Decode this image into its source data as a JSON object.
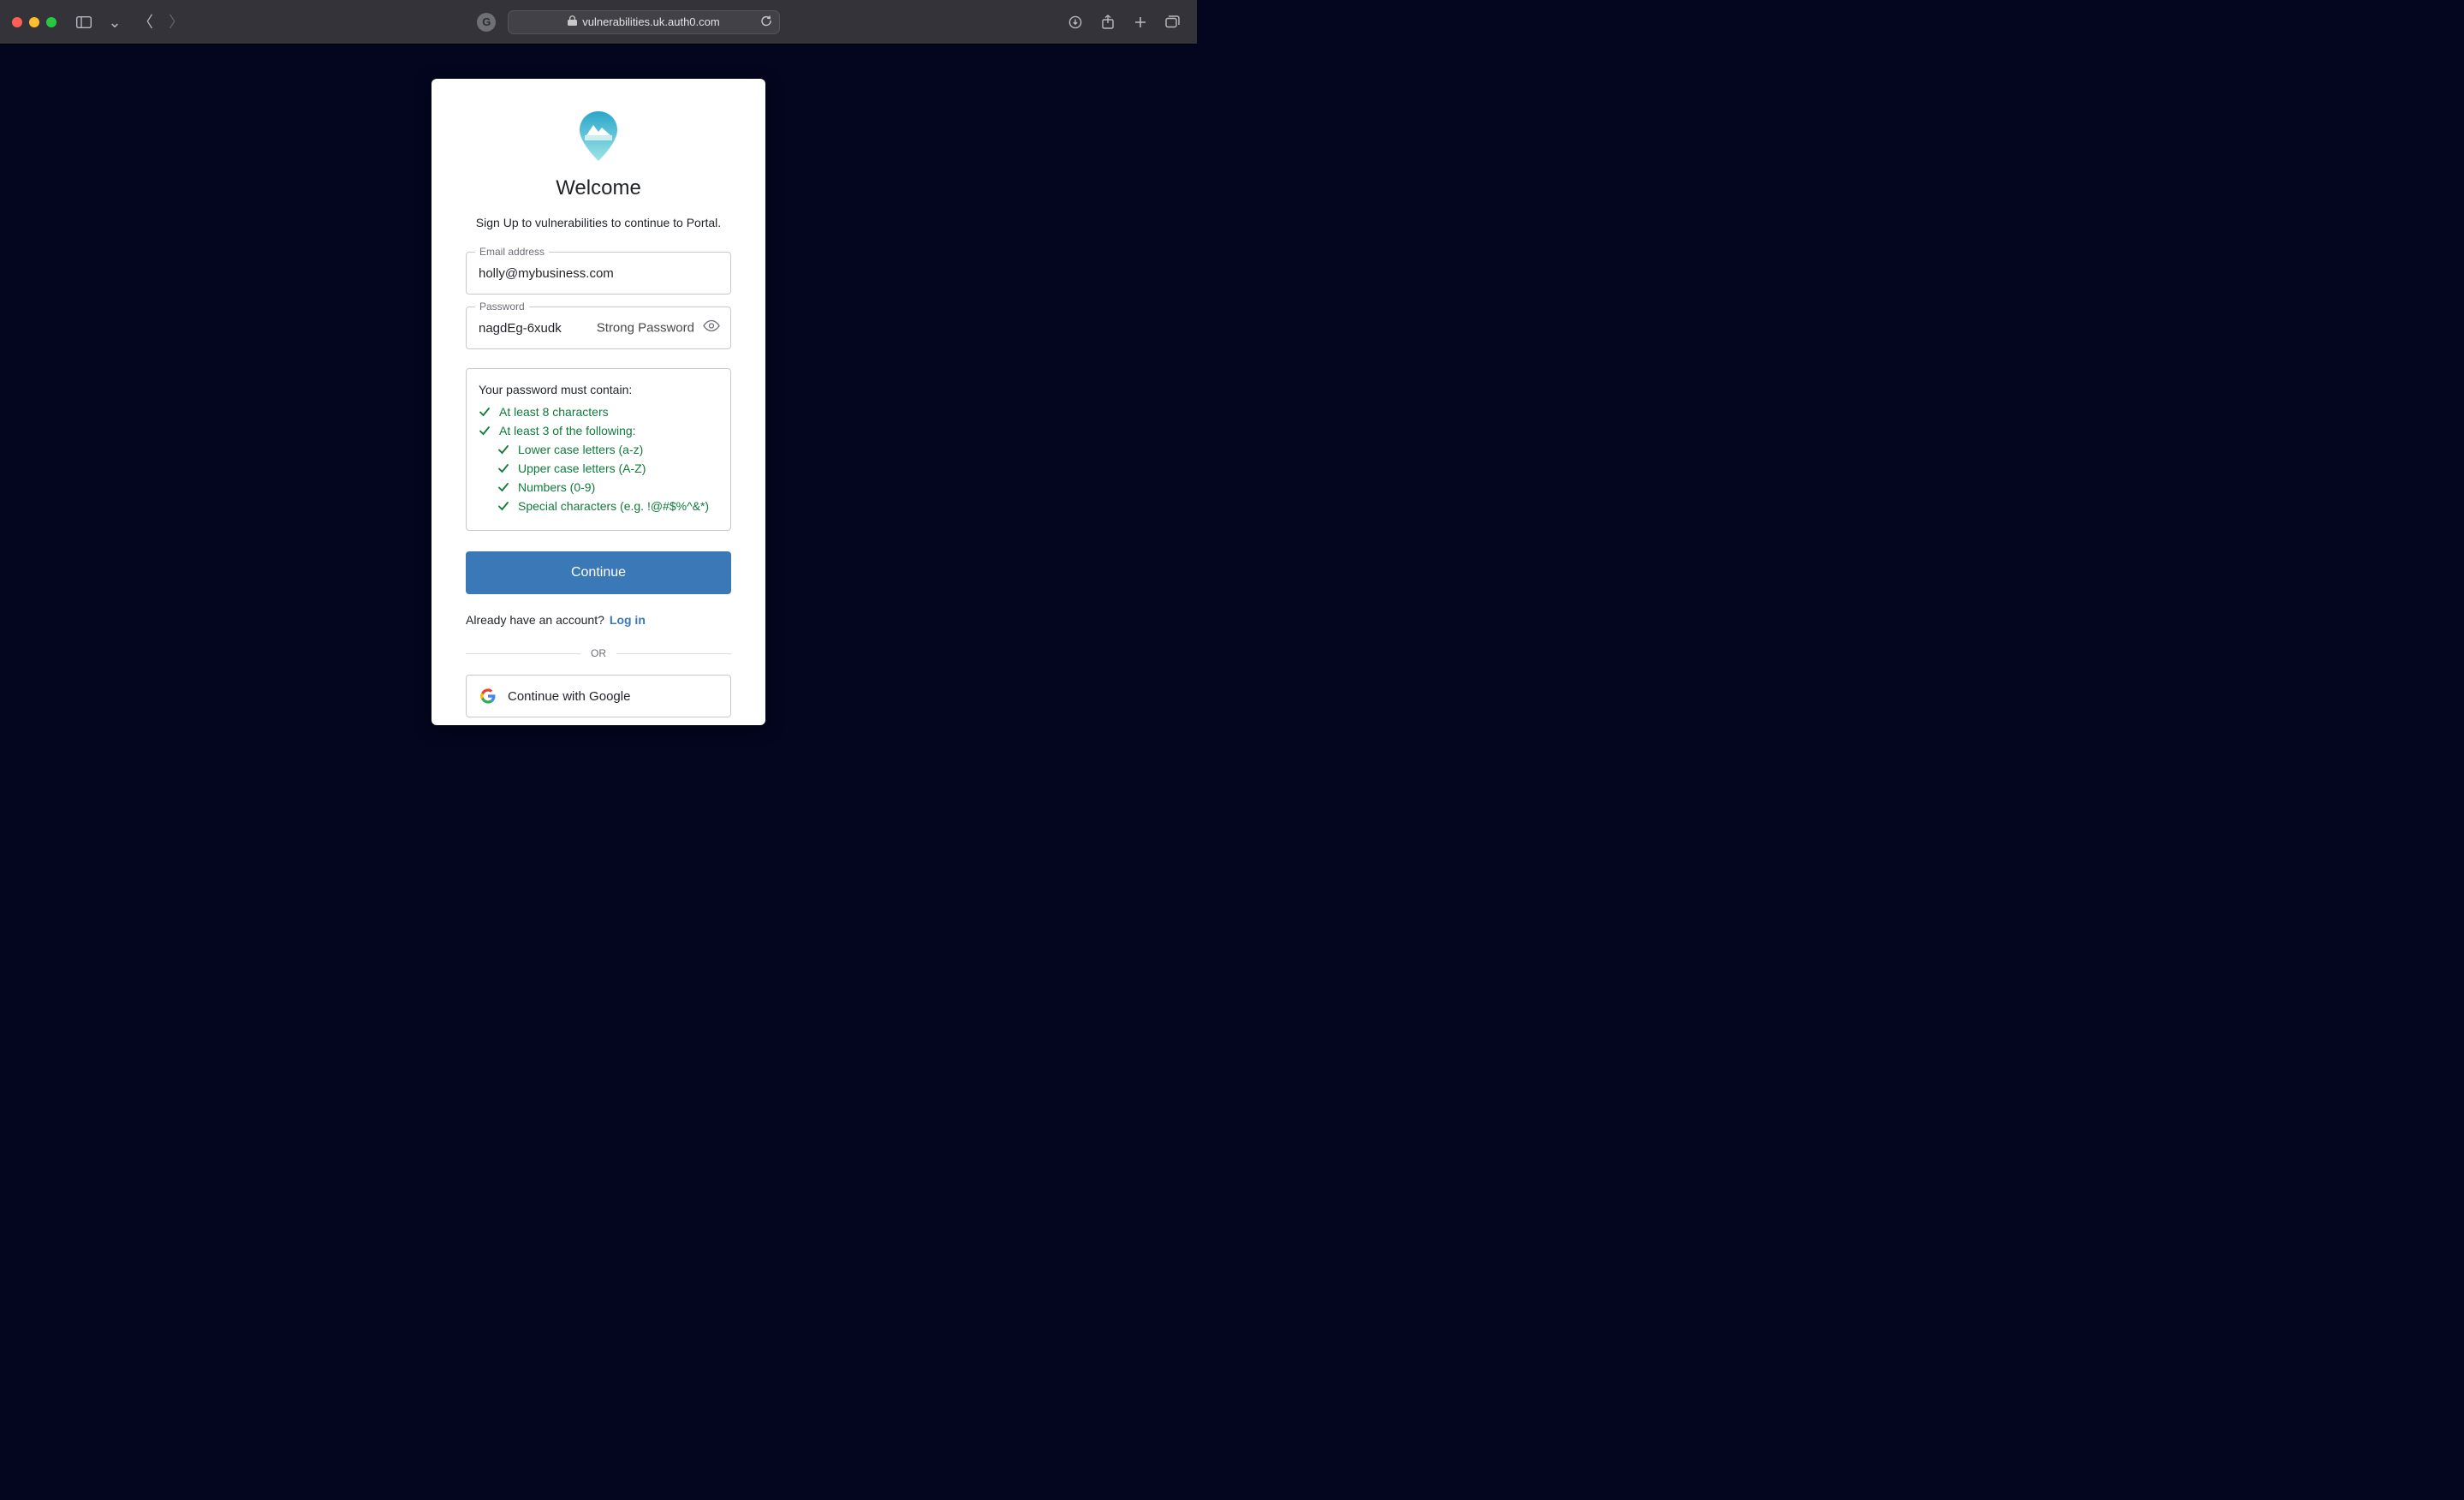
{
  "chrome": {
    "url": "vulnerabilities.uk.auth0.com"
  },
  "card": {
    "title": "Welcome",
    "subtitle": "Sign Up to vulnerabilities to continue to Portal.",
    "email_label": "Email address",
    "email_value": "holly@mybusiness.com",
    "password_label": "Password",
    "password_value": "nagdEg-6xudk",
    "password_strength": "Strong Password",
    "rules_heading": "Your password must contain:",
    "rules_primary": [
      "At least 8 characters",
      "At least 3 of the following:"
    ],
    "rules_sub": [
      "Lower case letters (a-z)",
      "Upper case letters (A-Z)",
      "Numbers (0-9)",
      "Special characters (e.g. !@#$%^&*)"
    ],
    "continue_label": "Continue",
    "already_text": "Already have an account?",
    "login_link": "Log in",
    "or_label": "OR",
    "google_label": "Continue with Google"
  }
}
